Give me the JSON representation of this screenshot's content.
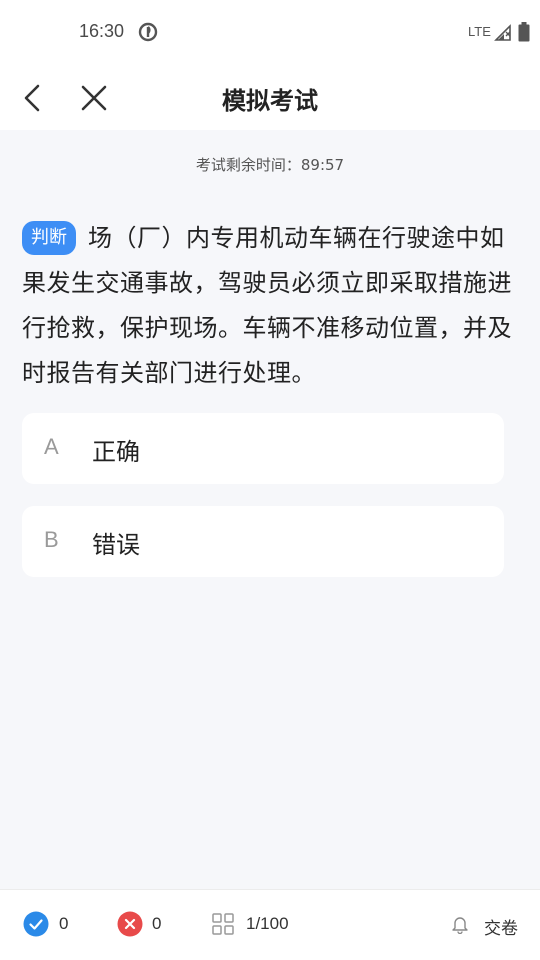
{
  "status_bar": {
    "time": "16:30",
    "network": "LTE"
  },
  "nav": {
    "title": "模拟考试"
  },
  "exam": {
    "timer_label": "考试剩余时间：89:57",
    "question_type": "判断",
    "question_text": "场（厂）内专用机动车辆在行驶途中如果发生交通事故，驾驶员必须立即采取措施进行抢救，保护现场。车辆不准移动位置，并及时报告有关部门进行处理。",
    "options": [
      {
        "letter": "A",
        "text": "正确"
      },
      {
        "letter": "B",
        "text": "错误"
      }
    ]
  },
  "bottom_bar": {
    "correct_count": "0",
    "wrong_count": "0",
    "progress": "1/100",
    "submit_label": "交卷"
  },
  "colors": {
    "accent": "#3d8ef5",
    "correct": "#2b8ae8",
    "wrong": "#e84a4a",
    "background": "#f6f7fa"
  }
}
